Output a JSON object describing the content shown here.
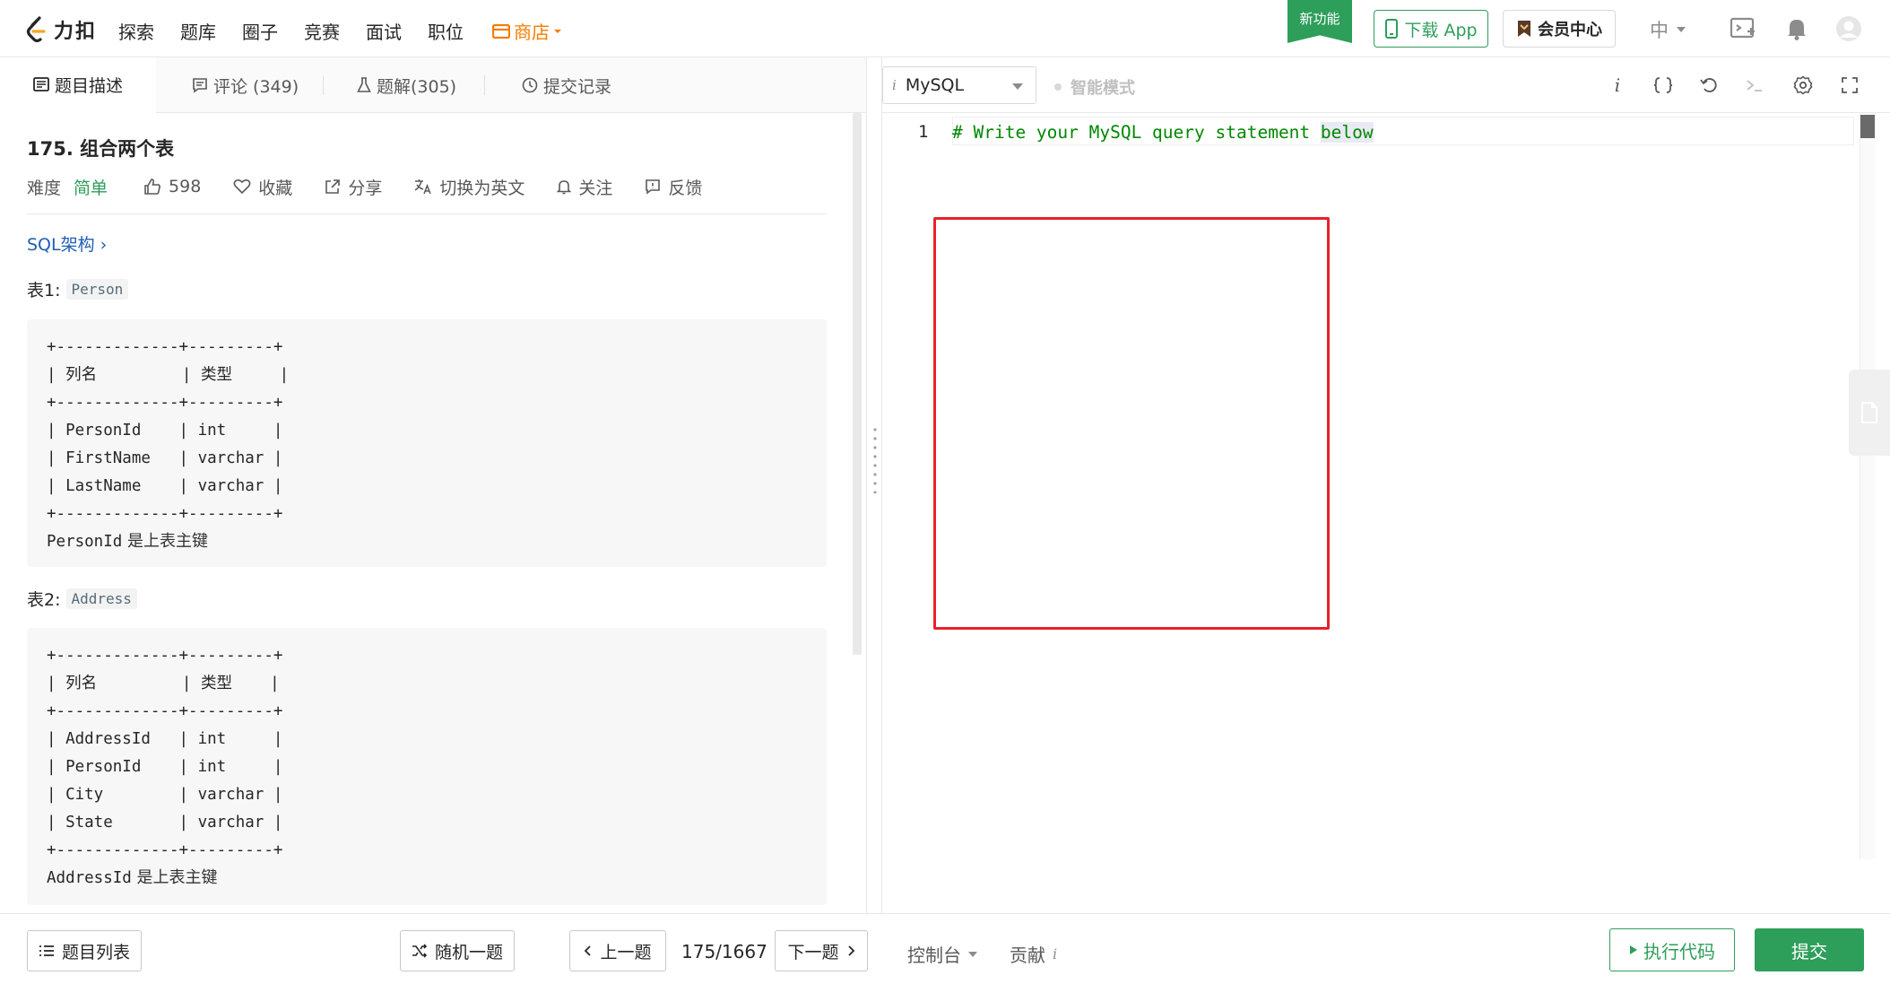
{
  "nav": {
    "logo_text": "力扣",
    "links": [
      "探索",
      "题库",
      "圈子",
      "竞赛",
      "面试",
      "职位"
    ],
    "store": "商店",
    "new_feature": "新功能",
    "download_app": "下载 App",
    "vip_center": "会员中心",
    "lang": "中"
  },
  "tabs": {
    "description": "题目描述",
    "comments": "评论 (349)",
    "solutions": "题解(305)",
    "submissions": "提交记录"
  },
  "problem": {
    "title": "175. 组合两个表",
    "difficulty_label": "难度",
    "difficulty": "简单",
    "likes": "598",
    "favorite": "收藏",
    "share": "分享",
    "switch_lang": "切换为英文",
    "follow": "关注",
    "feedback": "反馈",
    "schema_link": "SQL架构 ›",
    "table1_label": "表1:",
    "table1_name": "Person",
    "table1_ascii": "+-------------+---------+\n| 列名         | 类型     |\n+-------------+---------+\n| PersonId    | int     |\n| FirstName   | varchar |\n| LastName    | varchar |\n+-------------+---------+",
    "table1_pk_code": "PersonId",
    "table1_pk_text": " 是上表主键",
    "table2_label": "表2:",
    "table2_name": "Address",
    "table2_ascii": "+-------------+---------+\n| 列名         | 类型    |\n+-------------+---------+\n| AddressId   | int     |\n| PersonId    | int     |\n| City        | varchar |\n| State       | varchar |\n+-------------+---------+",
    "table2_pk_code": "AddressId",
    "table2_pk_text": " 是上表主键"
  },
  "editor": {
    "language": "MySQL",
    "smart_mode": "智能模式",
    "line_number": "1",
    "code_before": "# Write your MySQL query statement ",
    "code_highlight": "below"
  },
  "bottom": {
    "problem_list": "题目列表",
    "random": "随机一题",
    "prev": "上一题",
    "pager": "175/1667",
    "next": "下一题",
    "console": "控制台",
    "contribute": "贡献",
    "run": "执行代码",
    "submit": "提交"
  },
  "colors": {
    "brand_green": "#2e9e5b",
    "store_orange": "#f57c00",
    "link_blue": "#1d5fb5",
    "annotation_red": "#e8212b"
  }
}
